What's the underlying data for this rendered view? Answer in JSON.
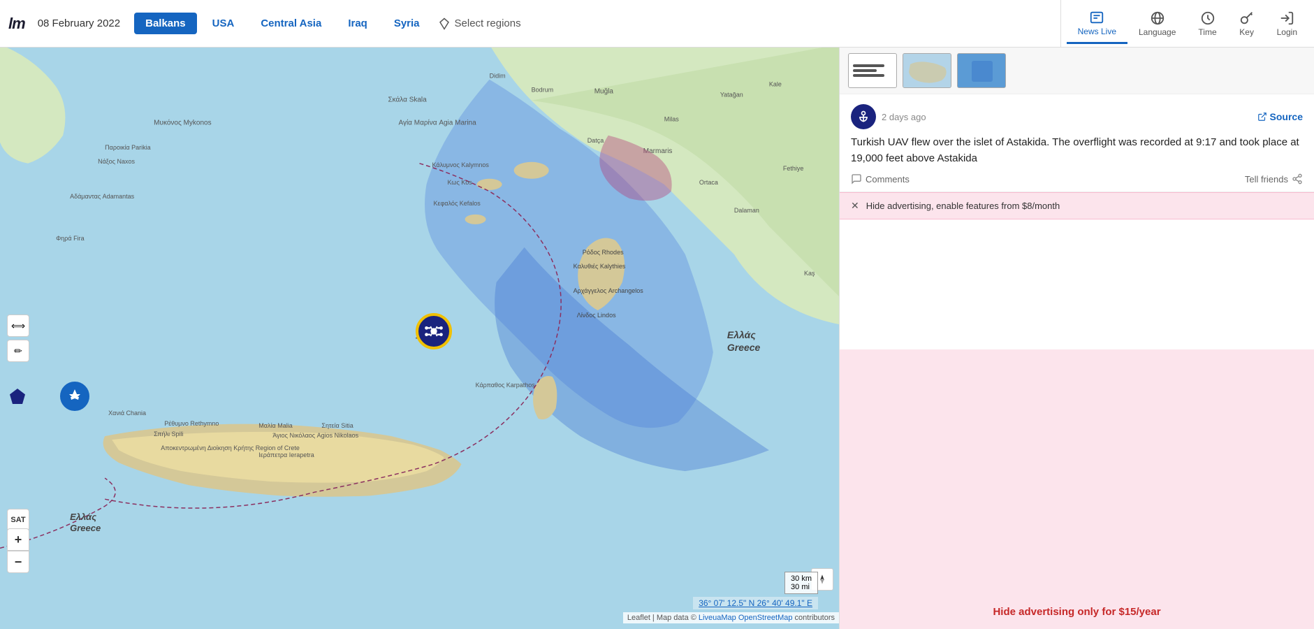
{
  "app": {
    "logo": "lm",
    "date": "08 February 2022"
  },
  "nav": {
    "regions": [
      {
        "id": "balkans",
        "label": "Balkans",
        "active": true
      },
      {
        "id": "usa",
        "label": "USA",
        "active": false
      },
      {
        "id": "central-asia",
        "label": "Central Asia",
        "active": false
      },
      {
        "id": "iraq",
        "label": "Iraq",
        "active": false
      },
      {
        "id": "syria",
        "label": "Syria",
        "active": false
      }
    ],
    "select_regions_label": "Select regions",
    "right_items": [
      {
        "id": "news-live",
        "label": "News Live",
        "active": true
      },
      {
        "id": "language",
        "label": "Language",
        "active": false
      },
      {
        "id": "time",
        "label": "Time",
        "active": false
      },
      {
        "id": "key",
        "label": "Key",
        "active": false
      },
      {
        "id": "login",
        "label": "Login",
        "active": false
      }
    ]
  },
  "map": {
    "coords": "36° 07' 12.5\" N 26° 40' 49.1\" E",
    "scale_km": "30 km",
    "scale_mi": "30 mi",
    "attribution": "Leaflet | Map data © LiveuaMap OpenStreetMap contributors",
    "crosshair": "+",
    "greece_label_1": "Ελλάς Greece",
    "greece_label_2": "Ελλάς\nGreece"
  },
  "map_controls": {
    "zoom_in": "+",
    "zoom_out": "−",
    "sat_label": "SAT",
    "arrows_label": "↕",
    "pen_label": "✎"
  },
  "sidebar": {
    "news_items": [
      {
        "id": "news-1",
        "time": "2 days ago",
        "source_label": "Source",
        "text": "Turkish UAV flew over the islet of Astakida. The overflight was recorded at 9:17 and took place at 19,000 feet above Astakida",
        "comments_label": "Comments",
        "tell_friends_label": "Tell friends"
      }
    ],
    "ad_strip": {
      "close_label": "✕",
      "text": "Hide advertising, enable features from $8/month"
    },
    "ad_block": {
      "text": "Hide advertising only for $15/year"
    }
  }
}
